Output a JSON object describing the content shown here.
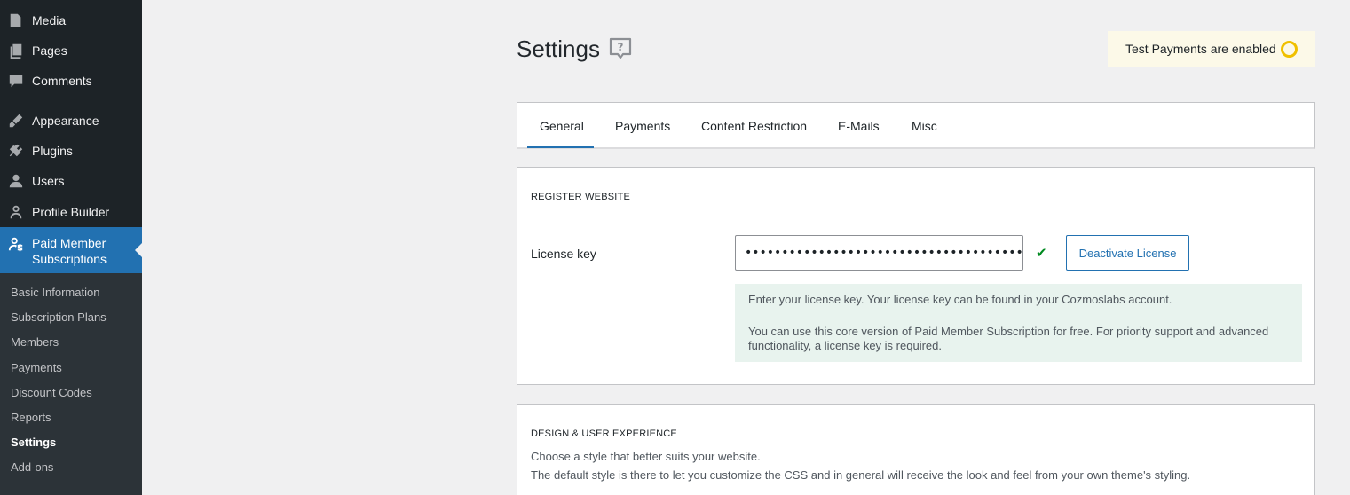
{
  "sidebar": {
    "menu": [
      {
        "label": "Media",
        "icon": "media-icon"
      },
      {
        "label": "Pages",
        "icon": "pages-icon"
      },
      {
        "label": "Comments",
        "icon": "comments-icon"
      },
      {
        "label": "Appearance",
        "icon": "appearance-icon"
      },
      {
        "label": "Plugins",
        "icon": "plugins-icon"
      },
      {
        "label": "Users",
        "icon": "users-icon"
      },
      {
        "label": "Profile Builder",
        "icon": "profile-builder-icon"
      },
      {
        "label": "Paid Member Subscriptions",
        "icon": "paid-member-icon"
      }
    ],
    "submenu": [
      {
        "label": "Basic Information"
      },
      {
        "label": "Subscription Plans"
      },
      {
        "label": "Members"
      },
      {
        "label": "Payments"
      },
      {
        "label": "Discount Codes"
      },
      {
        "label": "Reports"
      },
      {
        "label": "Settings"
      },
      {
        "label": "Add-ons"
      }
    ],
    "active_color": "#2271b1"
  },
  "header": {
    "title": "Settings",
    "test_badge": "Test Payments are enabled"
  },
  "tabs": [
    {
      "label": "General",
      "active": true
    },
    {
      "label": "Payments"
    },
    {
      "label": "Content Restriction"
    },
    {
      "label": "E-Mails"
    },
    {
      "label": "Misc"
    }
  ],
  "register": {
    "heading": "REGISTER WEBSITE",
    "license_label": "License key",
    "license_value": "••••••••••••••••••••••••••••••••••••••••••••••••••",
    "deactivate_label": "Deactivate License",
    "notice_line1": "Enter your license key. Your license key can be found in your Cozmoslabs account.",
    "notice_line2": "You can use this core version of Paid Member Subscription for free. For priority support and advanced functionality, a license key is required."
  },
  "design": {
    "heading": "DESIGN & USER EXPERIENCE",
    "line1": "Choose a style that better suits your website.",
    "line2": "The default style is there to let you customize the CSS and in general will receive the look and feel from your own theme's styling."
  }
}
